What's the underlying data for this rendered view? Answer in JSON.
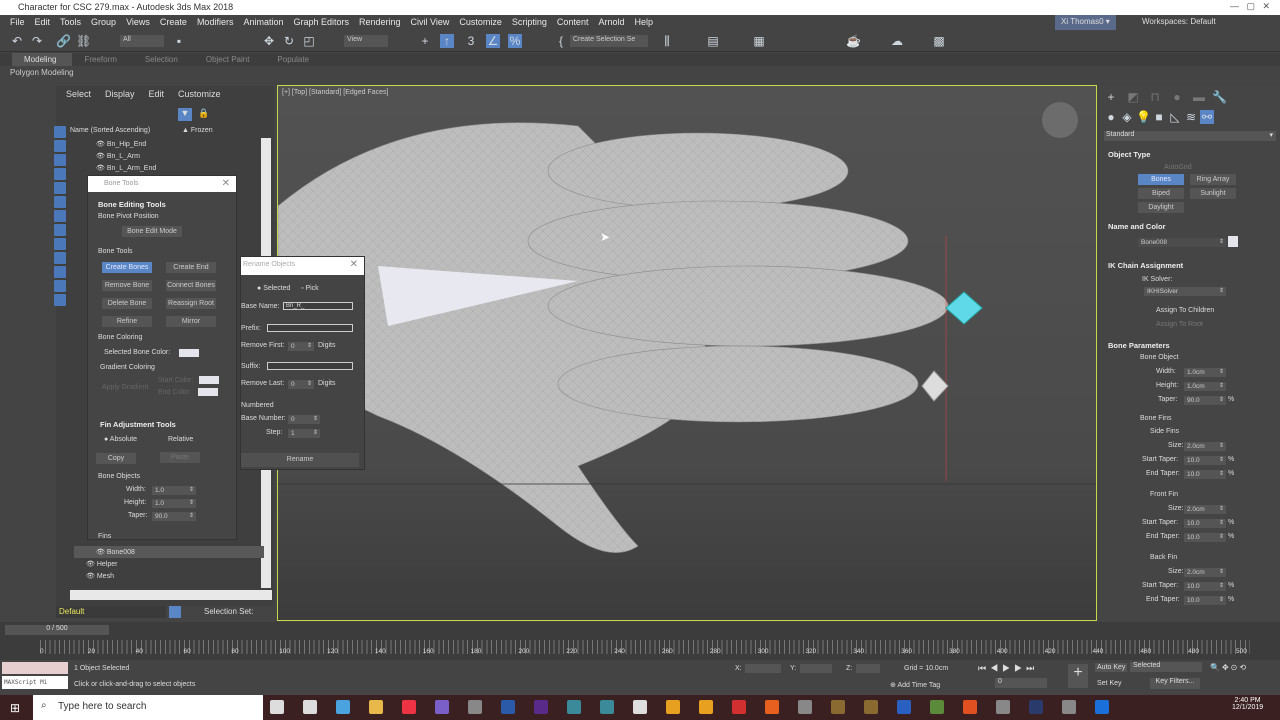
{
  "window": {
    "title": "Character for CSC 279.max - Autodesk 3ds Max 2018",
    "user": "Xi Thomas0",
    "workspaces": "Workspaces: Default"
  },
  "menu": [
    "File",
    "Edit",
    "Tools",
    "Group",
    "Views",
    "Create",
    "Modifiers",
    "Animation",
    "Graph Editors",
    "Rendering",
    "Civil View",
    "Customize",
    "Scripting",
    "Content",
    "Arnold",
    "Help"
  ],
  "toolbar": {
    "filter": "All",
    "view": "View",
    "selection_set": "Create Selection Se"
  },
  "ribbon": {
    "tabs": [
      "Modeling",
      "Freeform",
      "Selection",
      "Object Paint",
      "Populate"
    ],
    "active": "Modeling",
    "subtitle": "Polygon Modeling"
  },
  "explorer": {
    "menu": [
      "Select",
      "Display",
      "Edit",
      "Customize"
    ],
    "col_name": "Name (Sorted Ascending)",
    "col_frozen": "▲ Frozen",
    "items_top": [
      "Bn_Hip_End",
      "Bn_L_Arm",
      "Bn_L_Arm_End"
    ],
    "items_bottom": [
      "Bone008",
      "Helper",
      "Mesh"
    ],
    "layer": "Default",
    "selection_set": "Selection Set:"
  },
  "viewport": {
    "label": "[+] [Top] [Standard] [Edged Faces]"
  },
  "bone_tools": {
    "title": "Bone Tools",
    "editing": "Bone Editing Tools",
    "pivot": "Bone Pivot Position",
    "edit_mode": "Bone Edit Mode",
    "tools": "Bone Tools",
    "buttons": [
      "Create Bones",
      "Create End",
      "Remove Bone",
      "Connect Bones",
      "Delete Bone",
      "Reassign Root",
      "Refine",
      "Mirror"
    ],
    "coloring": "Bone Coloring",
    "sel_color": "Selected Bone Color:",
    "gradient": "Gradient Coloring",
    "apply_gradient": "Apply Gradient",
    "start_color": "Start Color:",
    "end_color": "End Color:",
    "fin": "Fin Adjustment Tools",
    "absolute": "Absolute",
    "relative": "Relative",
    "copy": "Copy",
    "paste": "Paste",
    "bone_objects": "Bone Objects",
    "width_l": "Width:",
    "width": "1.0",
    "height_l": "Height:",
    "height": "1.0",
    "taper_l": "Taper:",
    "taper": "90.0",
    "fins": "Fins"
  },
  "rename": {
    "title": "Rename Objects",
    "selected": "Selected",
    "pick": "Pick",
    "base_name_l": "Base Name:",
    "base_name": "Bn_R_",
    "prefix_l": "Prefix:",
    "remove_first_l": "Remove First:",
    "remove_first": "0",
    "digits": "Digits",
    "suffix_l": "Suffix:",
    "remove_last_l": "Remove Last:",
    "remove_last": "0",
    "numbered": "Numbered",
    "base_number_l": "Base Number:",
    "base_number": "0",
    "step_l": "Step:",
    "step": "1",
    "rename": "Rename"
  },
  "cmd": {
    "dropdown": "Standard",
    "object_type": "Object Type",
    "autogrid": "AutoGrid",
    "types": [
      "Bones",
      "Ring Array",
      "Biped",
      "Sunlight",
      "Daylight"
    ],
    "name_color": "Name and Color",
    "name": "Bone008",
    "ik": "IK Chain Assignment",
    "ik_solver_l": "IK Solver:",
    "ik_solver": "IKHISolver",
    "assign_children": "Assign To Children",
    "assign_root": "Assign To Root",
    "bone_params": "Bone Parameters",
    "bone_object": "Bone Object",
    "width": "1.0cm",
    "height": "1.0cm",
    "taper": "90.0",
    "bone_fins": "Bone Fins",
    "fins": [
      {
        "name": "Side Fins",
        "size": "2.0cm",
        "start": "10.0",
        "end": "10.0"
      },
      {
        "name": "Front Fin",
        "size": "2.0cm",
        "start": "10.0",
        "end": "10.0"
      },
      {
        "name": "Back Fin",
        "size": "2.0cm",
        "start": "10.0",
        "end": "10.0"
      }
    ],
    "l_width": "Width:",
    "l_height": "Height:",
    "l_taper": "Taper:",
    "l_size": "Size:",
    "l_start": "Start Taper:",
    "l_end": "End Taper:",
    "pct": "%"
  },
  "timeline": {
    "frame": "0 / 500",
    "ticks": [
      "0",
      "20",
      "40",
      "60",
      "80",
      "100",
      "120",
      "140",
      "160",
      "180",
      "200",
      "220",
      "240",
      "260",
      "280",
      "300",
      "320",
      "340",
      "360",
      "380",
      "400",
      "420",
      "440",
      "460",
      "480",
      "500"
    ]
  },
  "status": {
    "maxscript": "MAXScript Mi",
    "selected": "1 Object Selected",
    "hint": "Click or click-and-drag to select objects",
    "x": "X:",
    "y": "Y:",
    "z": "Z:",
    "grid": "Grid = 10.0cm",
    "add_time_tag": "Add Time Tag",
    "auto_key": "Auto Key",
    "set_key": "Set Key",
    "key_mode": "Selected",
    "key_filters": "Key Filters...",
    "frame": "0"
  },
  "taskbar": {
    "search": "Type here to search",
    "time": "2:40 PM",
    "date": "12/1/2019"
  },
  "colors": {
    "accent": "#5b86c6",
    "viewport_border": "#c8d84a",
    "bone_cyan": "#5fd8e8"
  }
}
